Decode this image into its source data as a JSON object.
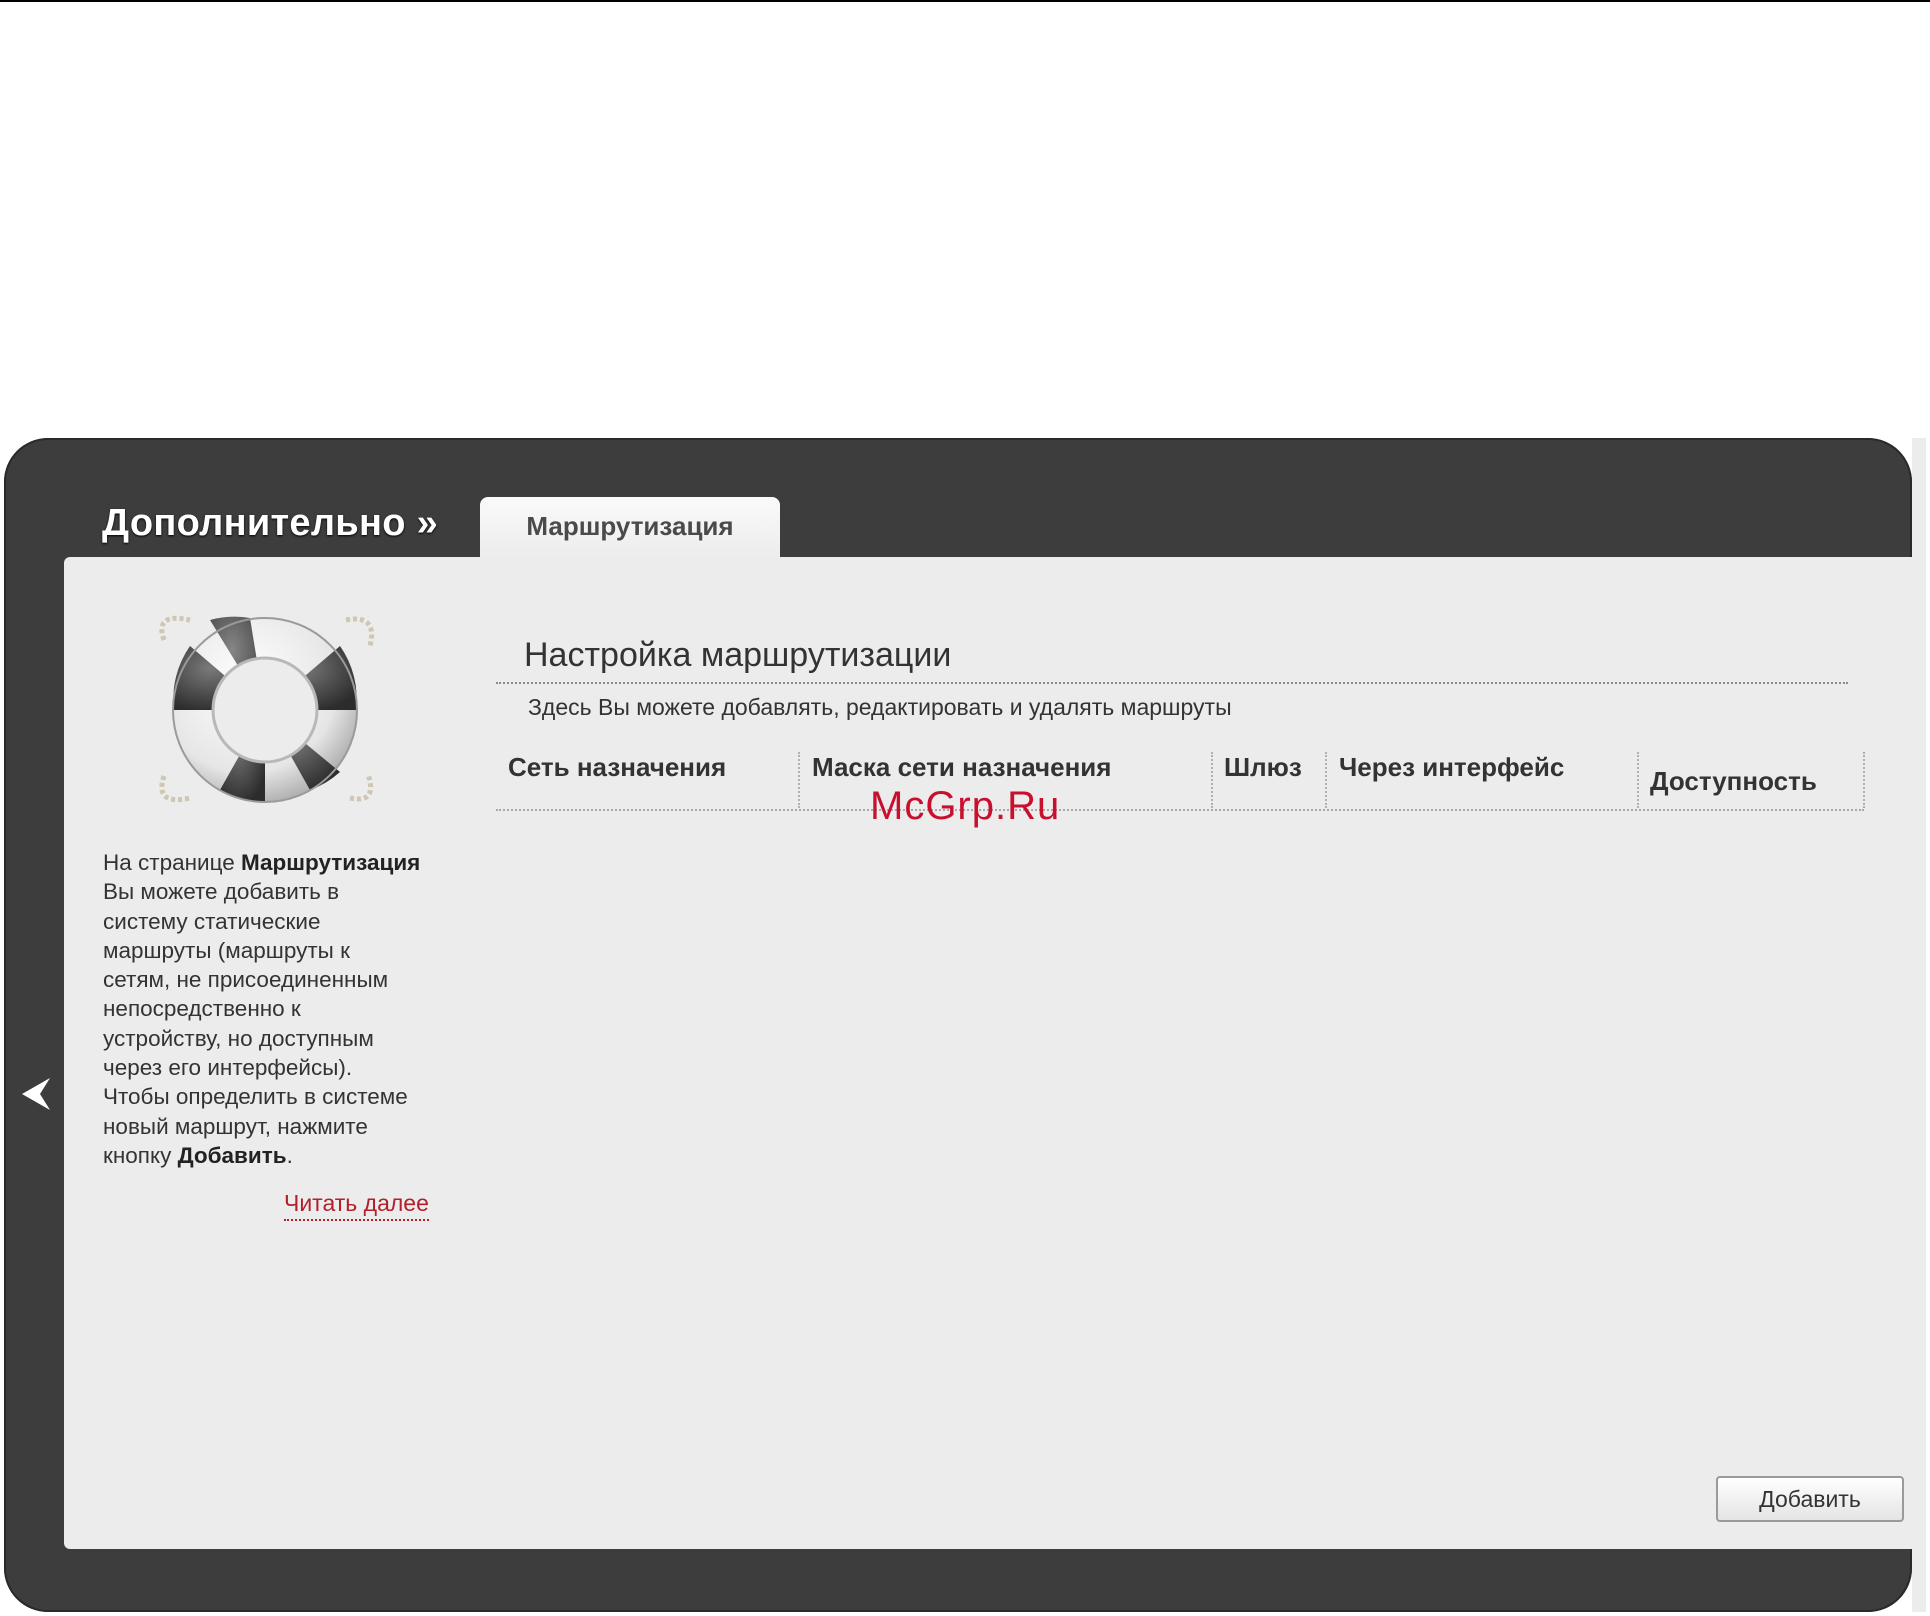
{
  "header": {
    "section_title": "Дополнительно »",
    "active_tab": "Маршрутизация"
  },
  "sidebar": {
    "icon": "lifebuoy-icon",
    "help_lines": [
      {
        "text": "На странице ",
        "bold": "Маршрутизация"
      },
      {
        "text": "Вы можете добавить в"
      },
      {
        "text": "систему статические"
      },
      {
        "text": "маршруты (маршруты к"
      },
      {
        "text": "сетям, не присоединенным"
      },
      {
        "text": "непосредственно к"
      },
      {
        "text": "устройству, но доступным"
      },
      {
        "text": "через его интерфейсы)."
      },
      {
        "text": "Чтобы определить в системе"
      },
      {
        "text": "новый маршрут, нажмите"
      },
      {
        "text": "кнопку ",
        "bold": "Добавить",
        "after": "."
      }
    ],
    "read_more": "Читать далее"
  },
  "main": {
    "title": "Настройка маршрутизации",
    "description": "Здесь Вы можете добавлять, редактировать и удалять маршруты",
    "columns": [
      "Сеть назначения",
      "Маска сети назначения",
      "Шлюз",
      "Через интерфейс",
      "Доступность"
    ],
    "rows": [],
    "add_button": "Добавить"
  },
  "watermark": "McGrp.Ru",
  "colors": {
    "frame": "#3d3d3d",
    "content": "#ececec",
    "link": "#b3202a",
    "watermark": "#c8102e"
  }
}
